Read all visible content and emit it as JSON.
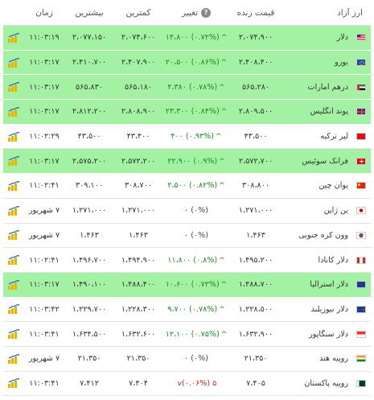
{
  "headers": {
    "name": "ارز آزاد",
    "live": "قیمت زنده",
    "change": "تغییر",
    "change_help": "?",
    "min": "کمترین",
    "max": "بیشترین",
    "time": "زمان"
  },
  "colors": {
    "green_row": "#a3f1a3",
    "up": "#1c8d1c",
    "down": "#c62828"
  },
  "rows": [
    {
      "flag": "us",
      "name": "دلار",
      "live": "۲،۰۷۴،۹۰۰",
      "change_dir": "up",
      "change": "(۰.۷۲%) ۱۴،۸۰۰",
      "min": "۲،۰۷۴،۶۰۰",
      "max": "۲،۰۷۷،۱۵۰",
      "time": "۱۱:۰۳:۱۹",
      "hl": true,
      "icon": "chart-icon"
    },
    {
      "flag": "eu",
      "name": "یورو",
      "live": "۲،۴۰۸،۴۰۰",
      "change_dir": "up",
      "change": "(۰.۸۶%) ۲۰،۵۰۰",
      "min": "۲،۴۰۷،۹۰۰",
      "max": "۲،۴۱۰،۷۰۰",
      "time": "۱۱:۰۳:۱۷",
      "hl": true,
      "icon": "chart-icon"
    },
    {
      "flag": "ae",
      "name": "درهم امارات",
      "live": "۵۶۵،۲۸۰",
      "change_dir": "up",
      "change": "(۰.۷۸%) ۴،۳۸۰",
      "min": "۵۶۵،۱۸۰",
      "max": "۵۶۵،۸۳۰",
      "time": "۱۱:۰۳:۱۷",
      "hl": true,
      "icon": "chart-icon"
    },
    {
      "flag": "gb",
      "name": "پوند انگلیس",
      "live": "۲،۸۰۹،۵۰۰",
      "change_dir": "up",
      "change": "(۰.۸۴%) ۲۳،۳۰۰",
      "min": "۲،۸۰۸،۹۰۰",
      "max": "۲،۸۱۲،۲۰۰",
      "time": "۱۱:۰۳:۱۷",
      "hl": true,
      "icon": "chart-icon"
    },
    {
      "flag": "tr",
      "name": "لیر ترکیه",
      "live": "۴۳،۵۰۰",
      "change_dir": "up",
      "change": "(۰.۹۳%) ۴۰۰",
      "min": "۴۳،۴۰۰",
      "max": "۴۳،۵۰۰",
      "time": "۱۱:۰۲:۲۹",
      "hl": false,
      "icon": "chart-icon"
    },
    {
      "flag": "ch",
      "name": "فرانک سوئیس",
      "live": "۲،۵۷۲،۷۰۰",
      "change_dir": "up",
      "change": "(۰.۹%) ۲۲،۹۰۰",
      "min": "۲،۵۷۲،۲۰۰",
      "max": "۲،۵۷۵،۲۰۰",
      "time": "۱۱:۰۳:۱۷",
      "hl": true,
      "icon": "chart-icon"
    },
    {
      "flag": "cn",
      "name": "یوان چین",
      "live": "۳۰۸،۸۰۰",
      "change_dir": "up",
      "change": "(۰.۸۲%) ۲،۵۰۰",
      "min": "۳۰۸،۷۰۰",
      "max": "۳۰۹،۱۰۰",
      "time": "۱۱:۰۲:۴۱",
      "hl": false,
      "icon": "chart-icon"
    },
    {
      "flag": "jp",
      "name": "ین ژاپن",
      "live": "۱،۲۷۱،۰۰۰",
      "change_dir": "none",
      "change": "(۰%) ۰",
      "min": "۱،۲۷۱،۰۰۰",
      "max": "۱،۲۷۱،۰۰۰",
      "time": "۷ شهریور",
      "hl": false,
      "icon": "chart-icon"
    },
    {
      "flag": "kr",
      "name": "وون کره جنوبی",
      "live": "۱،۴۶۳",
      "change_dir": "none",
      "change": "(۰%) ۰",
      "min": "۱،۴۶۳",
      "max": "۱،۴۶۳",
      "time": "۷ شهریور",
      "hl": false,
      "icon": "chart-icon"
    },
    {
      "flag": "ca",
      "name": "دلار کانادا",
      "live": "۱،۴۹۵،۲۰۰",
      "change_dir": "up",
      "change": "(۰.۸%) ۱۱،۸۰۰",
      "min": "۱،۴۹۴،۹۰۰",
      "max": "۱،۴۹۶،۷۰۰",
      "time": "۱۱:۰۲:۴۱",
      "hl": false,
      "icon": "chart-icon"
    },
    {
      "flag": "au",
      "name": "دلار استرالیا",
      "live": "۱،۴۸۸،۷۰۰",
      "change_dir": "up",
      "change": "(۰.۷۲%) ۱۰،۶۰۰",
      "min": "۱،۴۸۸،۴۰۰",
      "max": "۱،۴۹۰،۱۰۰",
      "time": "۱۱:۰۳:۱۷",
      "hl": true,
      "icon": "chart-icon"
    },
    {
      "flag": "nz",
      "name": "دلار نیوزیلند",
      "live": "۱،۲۲۸،۵۰۰",
      "change_dir": "up",
      "change": "(۰.۷۸%) ۹،۷۰۰",
      "min": "۱،۲۲۸،۳۰۰",
      "max": "۱،۲۲۹،۷۰۰",
      "time": "۱۱:۰۳:۴۲",
      "hl": false,
      "icon": "chart-icon"
    },
    {
      "flag": "sg",
      "name": "دلار سنگاپور",
      "live": "۱،۶۳۲،۹۰۰",
      "change_dir": "up",
      "change": "(۰.۷۵%) ۱۲،۱۰۰",
      "min": "۱،۶۳۲،۶۰۰",
      "max": "۱،۶۳۴،۵۰۰",
      "time": "۱۱:۰۳:۴۱",
      "hl": false,
      "icon": "chart-icon"
    },
    {
      "flag": "in",
      "name": "روپیه هند",
      "live": "۲۱،۳۵۰",
      "change_dir": "none",
      "change": "(۰%) ۰",
      "min": "۲۱،۳۵۰",
      "max": "۲۱،۳۵۰",
      "time": "۷ شهریور",
      "hl": false,
      "icon": "chart-icon"
    },
    {
      "flag": "pk",
      "name": "روپیه پاکستان",
      "live": "۷،۴۰۵",
      "change_dir": "down",
      "change": "(۰.۰۶%) ۵",
      "min": "۷،۴۰۴",
      "max": "۷،۴۱۲",
      "time": "۱۱:۰۳:۴۱",
      "hl": false,
      "icon": "chart-icon"
    }
  ]
}
